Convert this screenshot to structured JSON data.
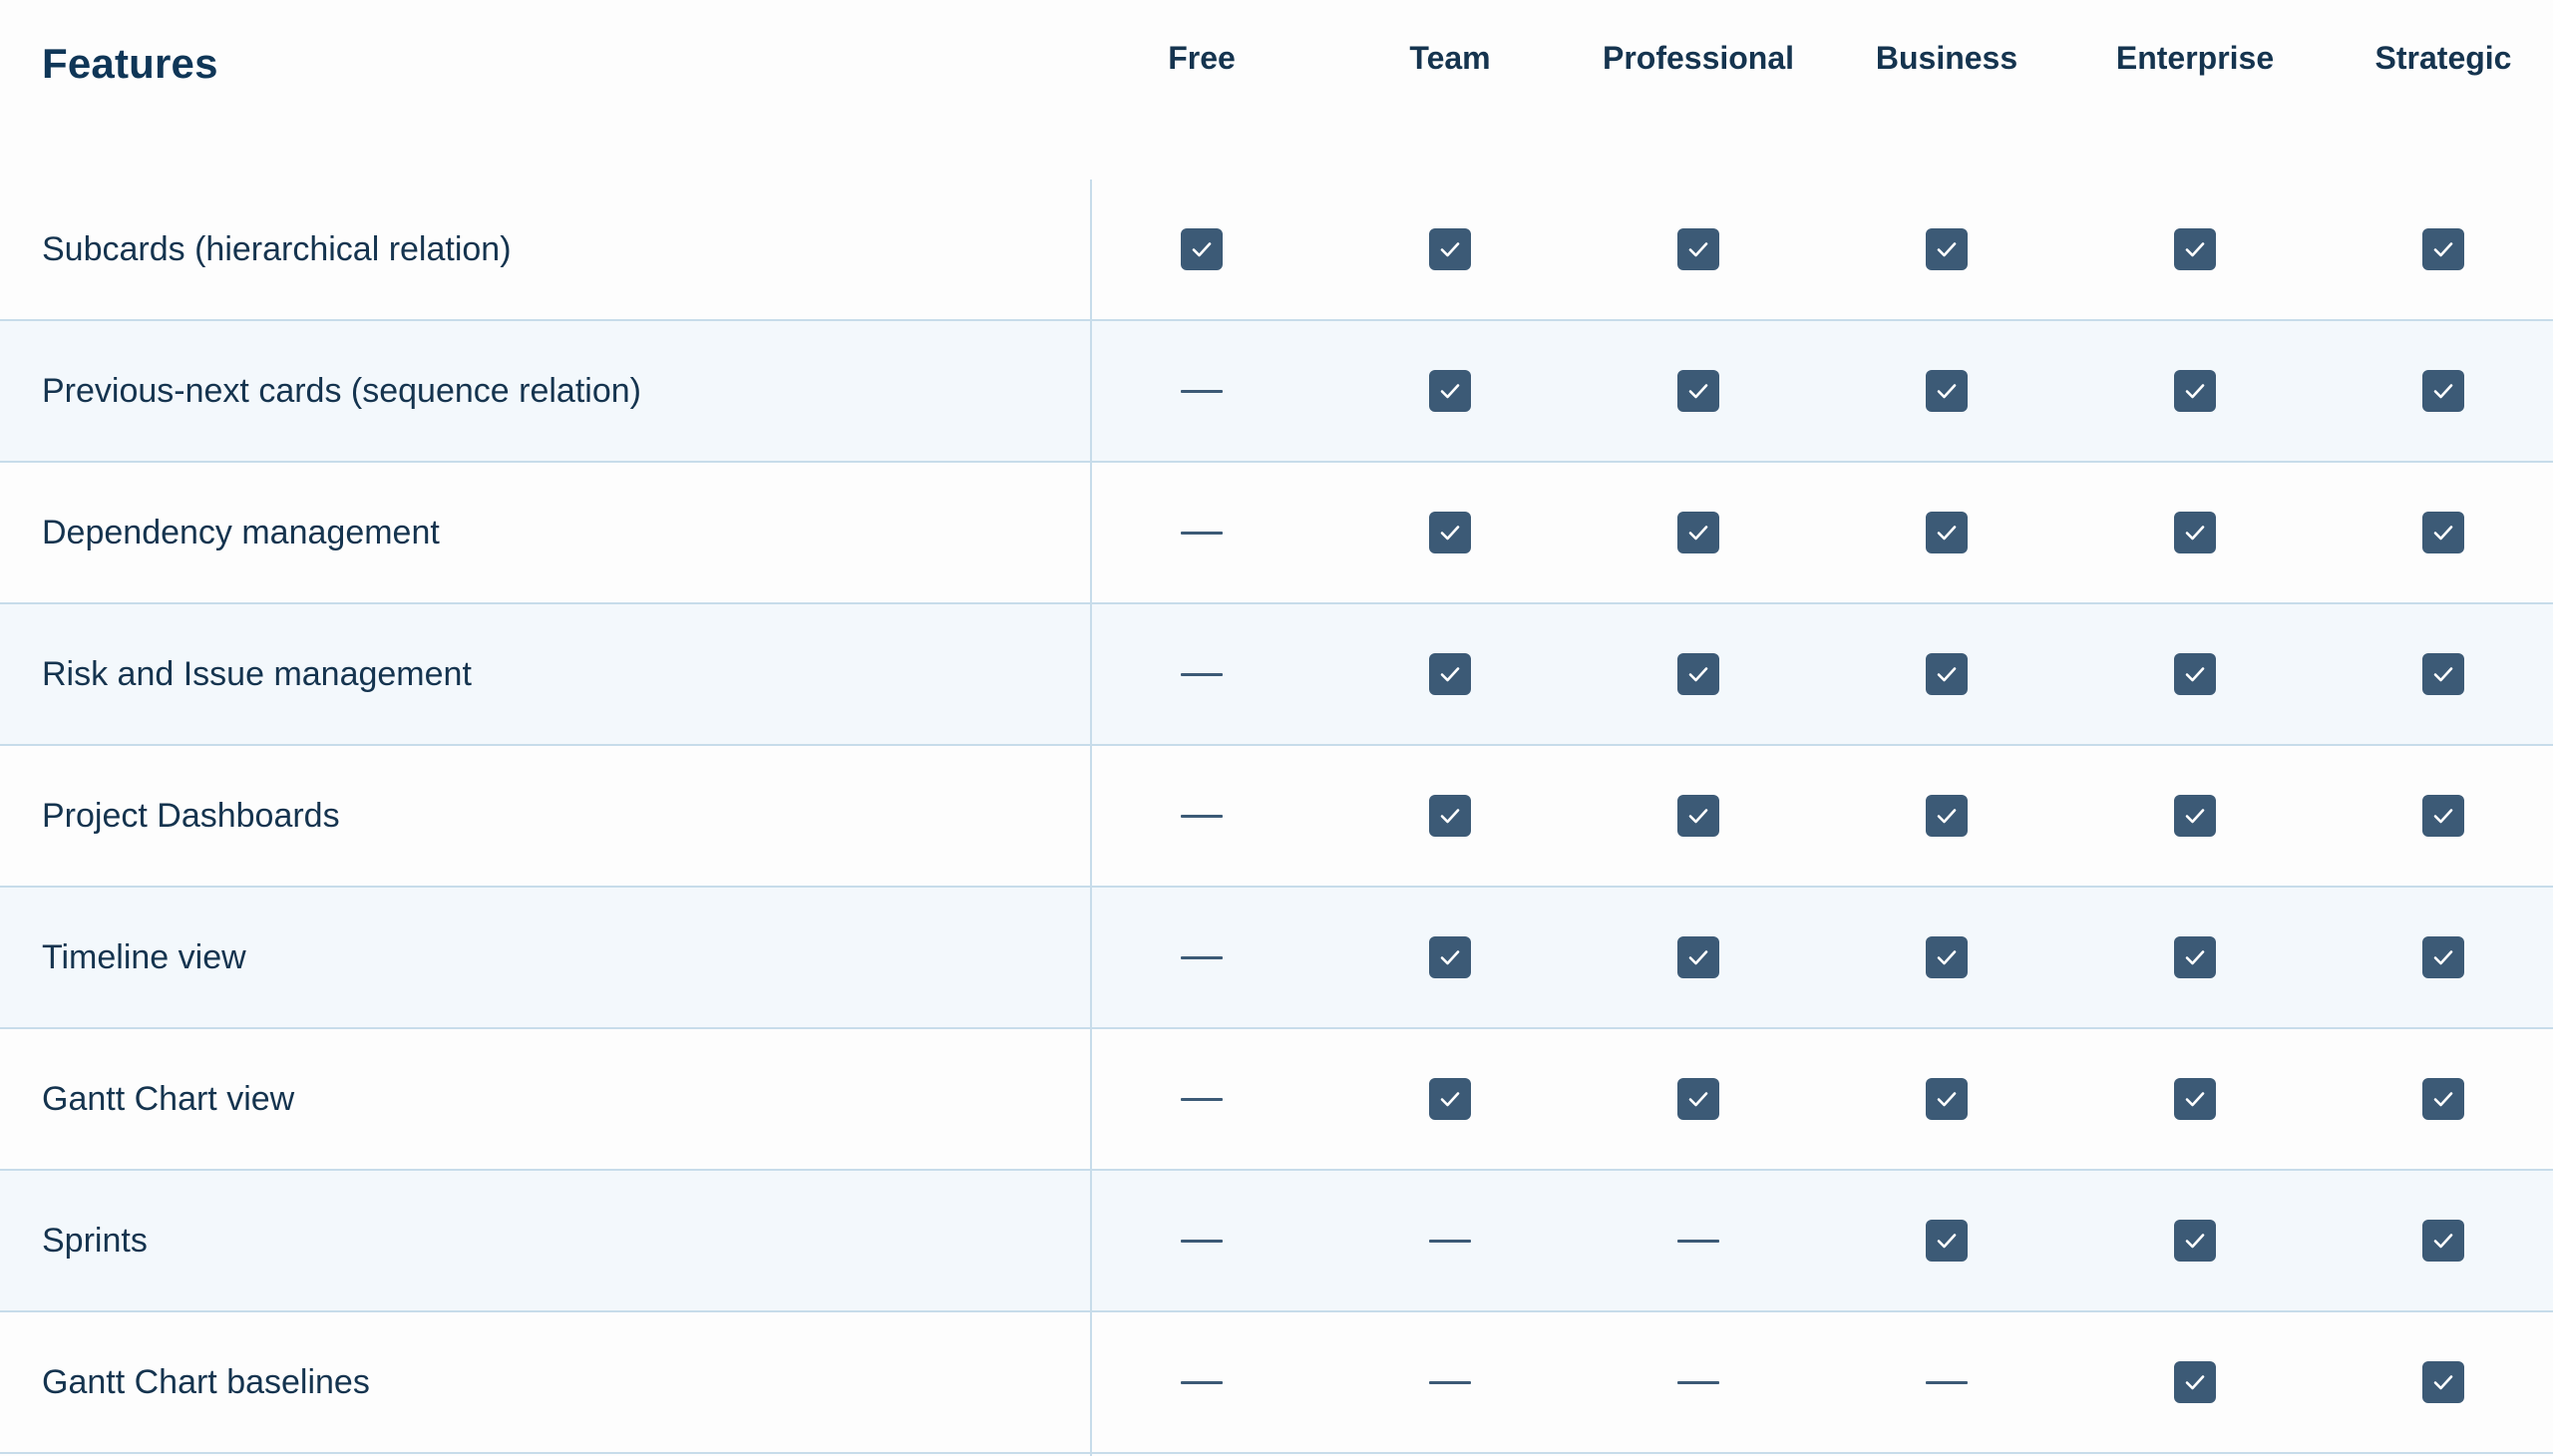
{
  "header": {
    "features_title": "Features",
    "plans": [
      "Free",
      "Team",
      "Professional",
      "Business",
      "Enterprise",
      "Strategic"
    ]
  },
  "icons": {
    "included": "check-icon",
    "not_included": "dash-icon"
  },
  "colors": {
    "text": "#15344f",
    "icon": "#3c5a76",
    "row_alt": "#f3f8fc",
    "divider": "#c7dcea"
  },
  "rows": [
    {
      "label": "Subcards (hierarchical relation)",
      "values": [
        true,
        true,
        true,
        true,
        true,
        true
      ]
    },
    {
      "label": "Previous-next cards (sequence relation)",
      "values": [
        false,
        true,
        true,
        true,
        true,
        true
      ]
    },
    {
      "label": "Dependency management",
      "values": [
        false,
        true,
        true,
        true,
        true,
        true
      ]
    },
    {
      "label": "Risk and Issue management",
      "values": [
        false,
        true,
        true,
        true,
        true,
        true
      ]
    },
    {
      "label": "Project Dashboards",
      "values": [
        false,
        true,
        true,
        true,
        true,
        true
      ]
    },
    {
      "label": "Timeline view",
      "values": [
        false,
        true,
        true,
        true,
        true,
        true
      ]
    },
    {
      "label": "Gantt Chart view",
      "values": [
        false,
        true,
        true,
        true,
        true,
        true
      ]
    },
    {
      "label": "Sprints",
      "values": [
        false,
        false,
        false,
        true,
        true,
        true
      ]
    },
    {
      "label": "Gantt Chart baselines",
      "values": [
        false,
        false,
        false,
        false,
        true,
        true
      ]
    }
  ]
}
